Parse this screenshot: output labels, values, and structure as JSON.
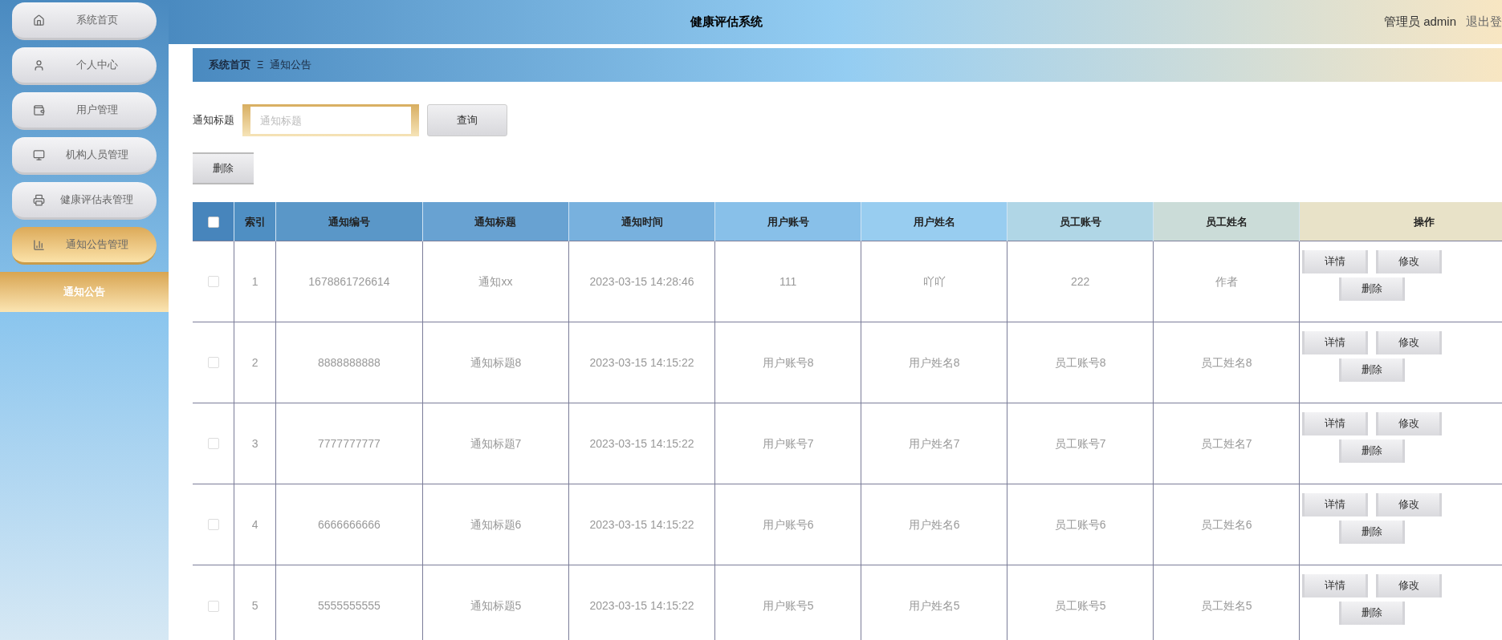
{
  "sidebar": {
    "items": [
      {
        "label": "系统首页",
        "selected": false
      },
      {
        "label": "个人中心",
        "selected": false
      },
      {
        "label": "用户管理",
        "selected": false
      },
      {
        "label": "机构人员管理",
        "selected": false
      },
      {
        "label": "健康评估表管理",
        "selected": false
      },
      {
        "label": "通知公告管理",
        "selected": true,
        "children": [
          {
            "label": "通知公告",
            "selected": true
          }
        ]
      }
    ]
  },
  "header": {
    "title": "健康评估系统",
    "user": "管理员 admin",
    "logout": "退出登"
  },
  "breadcrumb": {
    "home": "系统首页",
    "separator": "Ξ",
    "current": "通知公告"
  },
  "search": {
    "label": "通知标题",
    "placeholder": "通知标题",
    "button": "查询"
  },
  "toolbar": {
    "delete": "删除"
  },
  "table": {
    "header_checked": false,
    "columns": [
      "索引",
      "通知编号",
      "通知标题",
      "通知时间",
      "用户账号",
      "用户姓名",
      "员工账号",
      "员工姓名",
      "操作"
    ],
    "rows": [
      {
        "checked": false,
        "cells": [
          "1",
          "1678861726614",
          "通知xx",
          "2023-03-15 14:28:46",
          "111",
          "吖吖",
          "222",
          "作者"
        ],
        "actions": [
          "详情",
          "修改",
          "删除"
        ]
      },
      {
        "checked": false,
        "cells": [
          "2",
          "8888888888",
          "通知标题8",
          "2023-03-15 14:15:22",
          "用户账号8",
          "用户姓名8",
          "员工账号8",
          "员工姓名8"
        ],
        "actions": [
          "详情",
          "修改",
          "删除"
        ]
      },
      {
        "checked": false,
        "cells": [
          "3",
          "7777777777",
          "通知标题7",
          "2023-03-15 14:15:22",
          "用户账号7",
          "用户姓名7",
          "员工账号7",
          "员工姓名7"
        ],
        "actions": [
          "详情",
          "修改",
          "删除"
        ]
      },
      {
        "checked": false,
        "cells": [
          "4",
          "6666666666",
          "通知标题6",
          "2023-03-15 14:15:22",
          "用户账号6",
          "用户姓名6",
          "员工账号6",
          "员工姓名6"
        ],
        "actions": [
          "详情",
          "修改",
          "删除"
        ]
      },
      {
        "checked": false,
        "cells": [
          "5",
          "5555555555",
          "通知标题5",
          "2023-03-15 14:15:22",
          "用户账号5",
          "用户姓名5",
          "员工账号5",
          "员工姓名5"
        ],
        "actions": [
          "详情",
          "修改",
          "删除"
        ]
      }
    ]
  }
}
